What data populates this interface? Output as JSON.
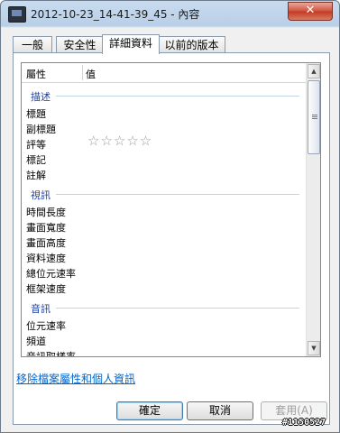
{
  "window": {
    "title": "2012-10-23_14-41-39_45 - 內容",
    "close_label": "✕"
  },
  "tabs": [
    {
      "label": "一般"
    },
    {
      "label": "安全性"
    },
    {
      "label": "詳細資料"
    },
    {
      "label": "以前的版本"
    }
  ],
  "active_tab": "詳細資料",
  "list": {
    "columns": {
      "name": "屬性",
      "value": "值"
    },
    "groups": [
      {
        "label": "描述",
        "rows": [
          "標題",
          "副標題",
          "評等",
          "標記",
          "註解"
        ]
      },
      {
        "label": "視訊",
        "rows": [
          "時間長度",
          "畫面寬度",
          "畫面高度",
          "資料速度",
          "總位元速率",
          "框架速度"
        ]
      },
      {
        "label": "音訊",
        "rows": [
          "位元速率",
          "頻道",
          "音訊取樣率"
        ]
      }
    ],
    "rating": {
      "label": "評等",
      "stars_filled": 0,
      "stars_total": 5,
      "glyph": "☆☆☆☆☆"
    }
  },
  "remove_link": "移除檔案屬性和個人資訊",
  "buttons": {
    "ok": "確定",
    "cancel": "取消",
    "apply": "套用(A)"
  },
  "scrollbar": {
    "up_icon": "▲",
    "down_icon": "▼"
  },
  "watermark": "#1150527"
}
